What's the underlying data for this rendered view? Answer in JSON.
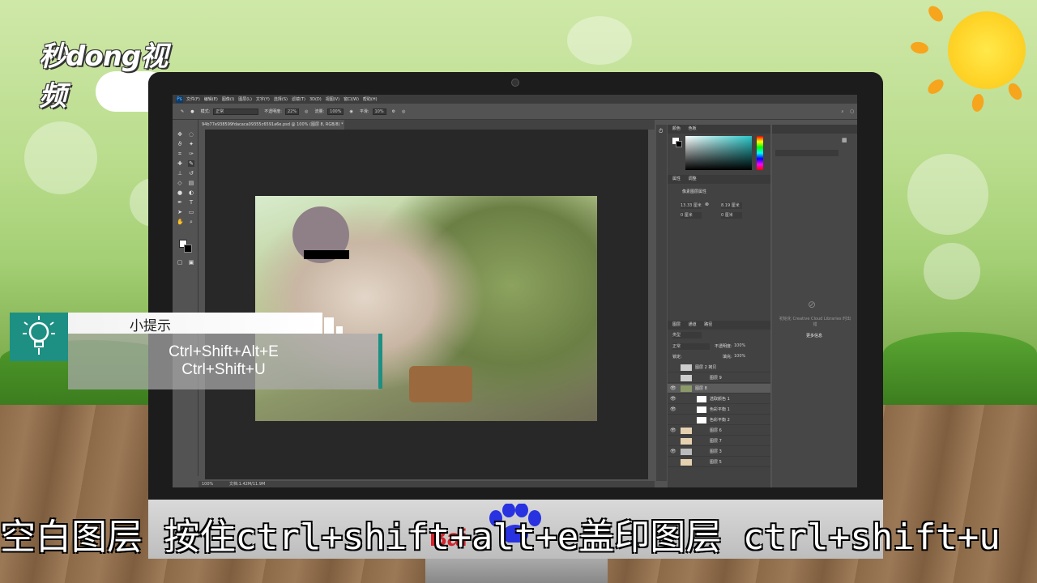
{
  "brand": {
    "logo_text": "秒dong视频"
  },
  "tip": {
    "title": "小提示",
    "line1": "Ctrl+Shift+Alt+E",
    "line2": "Ctrl+Shift+U"
  },
  "subtitle": "空白图层 按住ctrl+shift+alt+e盖印图层 ctrl+shift+u",
  "watermark": {
    "text": "Bai"
  },
  "photoshop": {
    "menu": [
      "文件(F)",
      "编辑(E)",
      "图像(I)",
      "图层(L)",
      "文字(Y)",
      "选择(S)",
      "滤镜(T)",
      "3D(D)",
      "视图(V)",
      "窗口(W)",
      "帮助(H)"
    ],
    "options": {
      "mode_label": "模式:",
      "mode_value": "正常",
      "opacity_label": "不透明度:",
      "opacity_value": "22%",
      "flow_label": "流量:",
      "flow_value": "100%",
      "smooth_label": "平滑:",
      "smooth_value": "10%"
    },
    "document_tab": "94b77e938599fdacaca09355c6591a6e.psd @ 100% (图层 8, RGB/8) *",
    "status": {
      "zoom": "100%",
      "doc_size": "文档:1.42M/11.9M"
    },
    "panels": {
      "color_tab": "颜色",
      "swatches_tab": "色板",
      "properties_tab": "属性",
      "adjustments_tab": "调整",
      "properties_title": "像素图层属性",
      "w_value": "13.33 厘米",
      "h_value": "8.19 厘米",
      "x_value": "0 厘米",
      "y_value": "0 厘米",
      "layers_tab": "图层",
      "channels_tab": "通道",
      "paths_tab": "路径",
      "kind_label": "类型",
      "blend_mode": "正常",
      "opacity_label": "不透明度:",
      "opacity_value": "100%",
      "lock_label": "锁定:",
      "fill_label": "填充:",
      "fill_value": "100%",
      "cc_text": "初始化 Creative Cloud Libraries 时出错",
      "cc_link": "更多信息"
    },
    "layers": [
      {
        "name": "图层 2 拷贝",
        "visible": false
      },
      {
        "name": "图层 9",
        "visible": false
      },
      {
        "name": "图层 8",
        "visible": true
      },
      {
        "name": "选取颜色 1",
        "visible": true
      },
      {
        "name": "色彩平衡 1",
        "visible": true
      },
      {
        "name": "色彩平衡 2",
        "visible": false
      },
      {
        "name": "图层 6",
        "visible": true
      },
      {
        "name": "图层 7",
        "visible": false
      },
      {
        "name": "图层 3",
        "visible": true
      },
      {
        "name": "图层 5",
        "visible": false
      }
    ]
  },
  "colors": {
    "accent": "#1e8f83",
    "baidu_red": "#d2232a",
    "baidu_blue": "#2932e1"
  }
}
